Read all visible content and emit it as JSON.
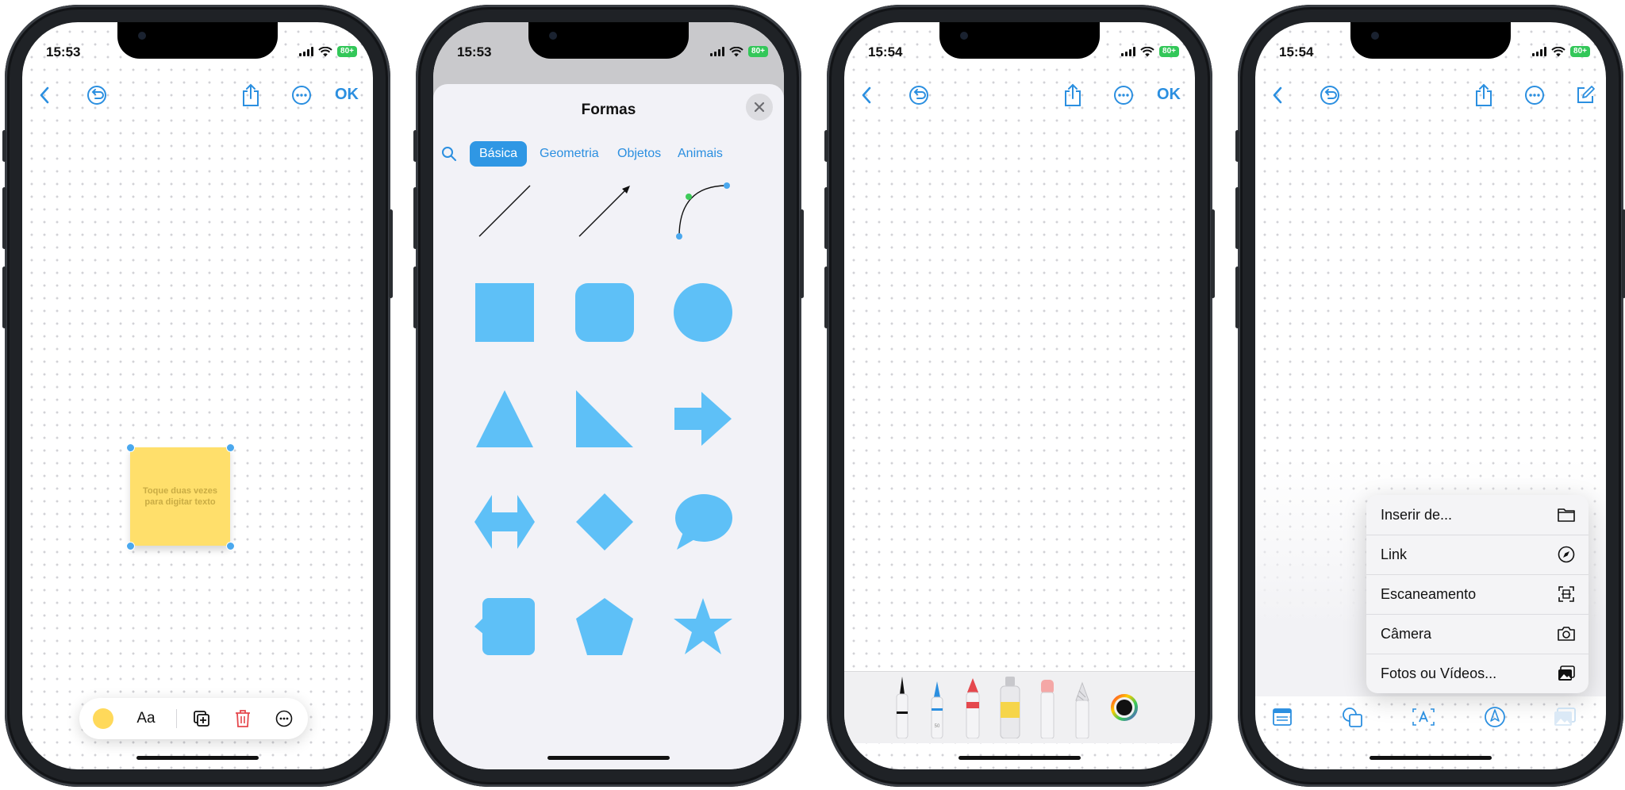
{
  "colors": {
    "accent": "#2b8fe0",
    "shape_fill": "#5ec0f7",
    "sticky": "#ffdf6b",
    "active_tab": "#2f97e4",
    "delete": "#e5484d"
  },
  "phones": [
    {
      "status": {
        "time": "15:53",
        "battery": "80+"
      },
      "toolbar": {
        "ok": "OK"
      },
      "sticky_note": {
        "placeholder": "Toque duas vezes para digitar texto"
      },
      "bottom_toolbar": {
        "text_style": "Aa"
      }
    },
    {
      "status": {
        "time": "15:53",
        "battery": "80+"
      },
      "sheet": {
        "title": "Formas",
        "tabs": [
          "Básica",
          "Geometria",
          "Objetos",
          "Animais"
        ],
        "active_tab": "Básica",
        "shapes": [
          "line",
          "arrow",
          "curve",
          "square",
          "rounded-square",
          "circle",
          "triangle",
          "right-triangle",
          "arrow-right",
          "double-arrow",
          "diamond",
          "speech-bubble",
          "callout-square",
          "pentagon",
          "star"
        ]
      }
    },
    {
      "status": {
        "time": "15:54",
        "battery": "80+"
      },
      "toolbar": {
        "ok": "OK"
      },
      "pen_tray": {
        "tools": [
          "fine-pen",
          "pen-50",
          "marker-red",
          "paint-tube-yellow",
          "eraser",
          "pencil",
          "color-picker"
        ],
        "pen_size_label": "50"
      }
    },
    {
      "status": {
        "time": "15:54",
        "battery": "80+"
      },
      "insert_menu": [
        {
          "label": "Inserir de...",
          "icon": "folder-icon"
        },
        {
          "label": "Link",
          "icon": "compass-icon"
        },
        {
          "label": "Escaneamento",
          "icon": "scan-icon"
        },
        {
          "label": "Câmera",
          "icon": "camera-icon"
        },
        {
          "label": "Fotos ou Vídeos...",
          "icon": "photos-icon"
        }
      ]
    }
  ]
}
